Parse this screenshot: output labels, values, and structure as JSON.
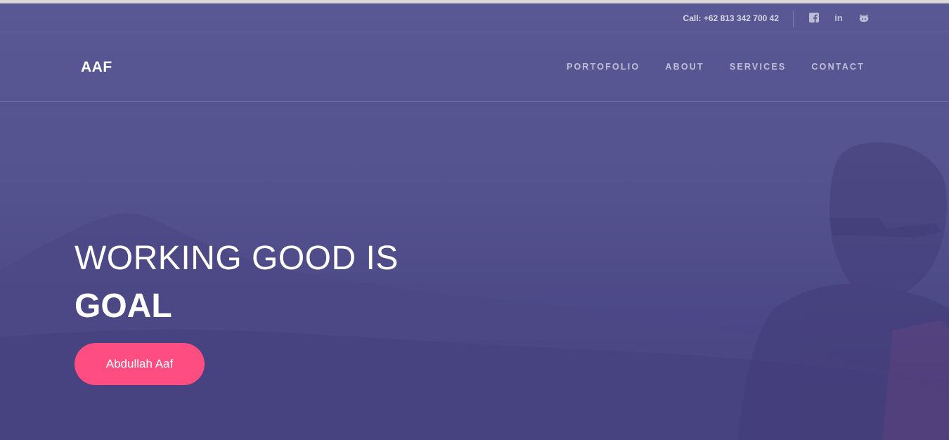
{
  "topbar": {
    "phone": "Call: +62 813 342 700 42",
    "social": [
      {
        "icon": "facebook-icon"
      },
      {
        "icon": "linkedin-icon",
        "glyph": "in"
      },
      {
        "icon": "github-icon"
      }
    ]
  },
  "navbar": {
    "logo": "AAF",
    "links": [
      {
        "label": "PORTOFOLIO"
      },
      {
        "label": "ABOUT"
      },
      {
        "label": "SERVICES"
      },
      {
        "label": "CONTACT"
      }
    ]
  },
  "hero": {
    "headline": "WORKING GOOD IS",
    "headline_strong": "GOAL",
    "cta_label": "Abdullah Aaf"
  },
  "colors": {
    "overlay": "#5a5894",
    "cta": "#fd4d81",
    "text": "#ffffff"
  }
}
